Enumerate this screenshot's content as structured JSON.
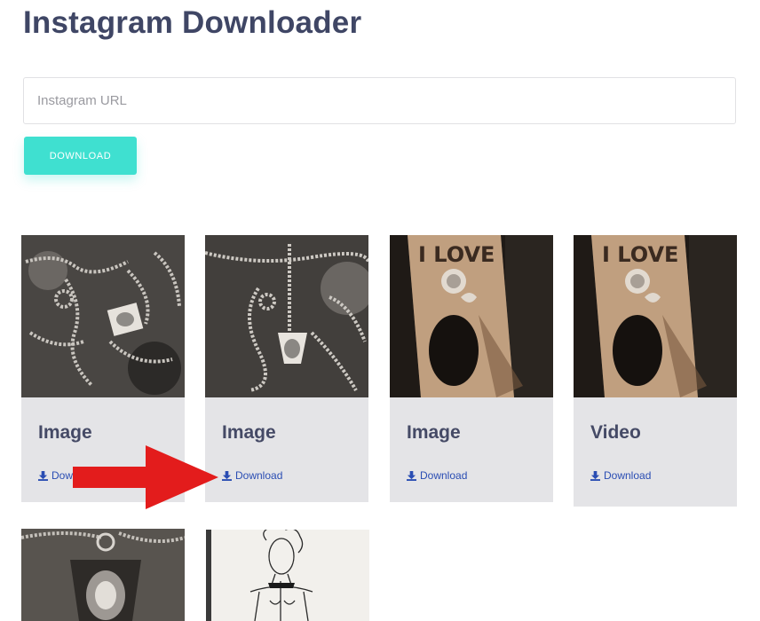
{
  "header": {
    "title": "Instagram Downloader"
  },
  "form": {
    "url_placeholder": "Instagram URL",
    "url_value": "",
    "download_button_label": "DOWNLOAD"
  },
  "results": [
    {
      "type_label": "Image",
      "link_label": "Download",
      "thumbnail": "chainmail jewelry on stone"
    },
    {
      "type_label": "Image",
      "link_label": "Download",
      "thumbnail": "chainmail jewelry on stone"
    },
    {
      "type_label": "Image",
      "link_label": "Download",
      "thumbnail": "wooden sign \"I LOVE\""
    },
    {
      "type_label": "Video",
      "link_label": "Download",
      "thumbnail": "wooden sign \"I LOVE\""
    }
  ],
  "more_results": [
    {
      "thumbnail": "silver pendant on stone"
    },
    {
      "thumbnail": "figure sketch drawing"
    }
  ],
  "thumbnail_sign_text": "I LOVE",
  "colors": {
    "title": "#3f4665",
    "button": "#3fe0d0",
    "card_bg": "#e4e4e7",
    "link": "#2a4db3",
    "arrow": "#e31c1c"
  },
  "icons": {
    "download_link": "download-icon",
    "annotation": "red-arrow"
  }
}
